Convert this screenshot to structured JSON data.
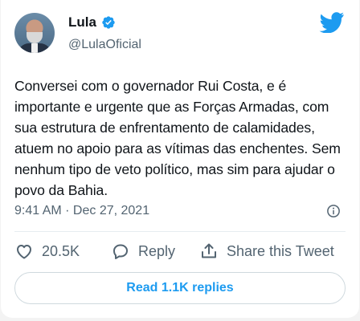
{
  "author": {
    "name": "Lula",
    "handle": "@LulaOficial",
    "verified": true
  },
  "tweet": {
    "text": "Conversei com o governador Rui Costa, e é importante e urgente que as Forças Armadas, com sua estrutura de enfrentamento de calamidades, atuem no apoio para as vítimas das enchentes. Sem nenhum tipo de veto político, mas sim para ajudar o povo da Bahia.",
    "timestamp": "9:41 AM · Dec 27, 2021"
  },
  "actions": {
    "like_count": "20.5K",
    "reply_label": "Reply",
    "share_label": "Share this Tweet"
  },
  "replies_button": "Read 1.1K replies",
  "icons": {
    "platform": "twitter-bird-icon",
    "verified": "verified-badge-icon",
    "info": "info-icon",
    "like": "heart-icon",
    "reply": "speech-bubble-icon",
    "share": "share-upload-icon"
  },
  "colors": {
    "accent": "#1d9bf0",
    "text": "#0f1419",
    "secondary": "#536471"
  }
}
